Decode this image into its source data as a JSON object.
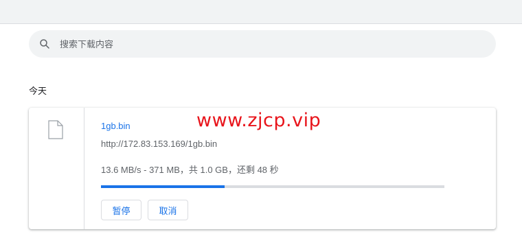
{
  "search": {
    "placeholder": "搜索下载内容",
    "value": ""
  },
  "section": {
    "date_label": "今天"
  },
  "download": {
    "file_name": "1gb.bin",
    "url": "http://172.83.153.169/1gb.bin",
    "status": "13.6 MB/s - 371 MB，共 1.0 GB，还剩 48 秒",
    "progress": 0.36,
    "pause_label": "暂停",
    "cancel_label": "取消"
  },
  "watermark": "www.zjcp.vip",
  "colors": {
    "accent": "#1a73e8",
    "watermark": "#e8141b"
  },
  "icons": {
    "search": "search-icon",
    "file": "file-icon"
  }
}
